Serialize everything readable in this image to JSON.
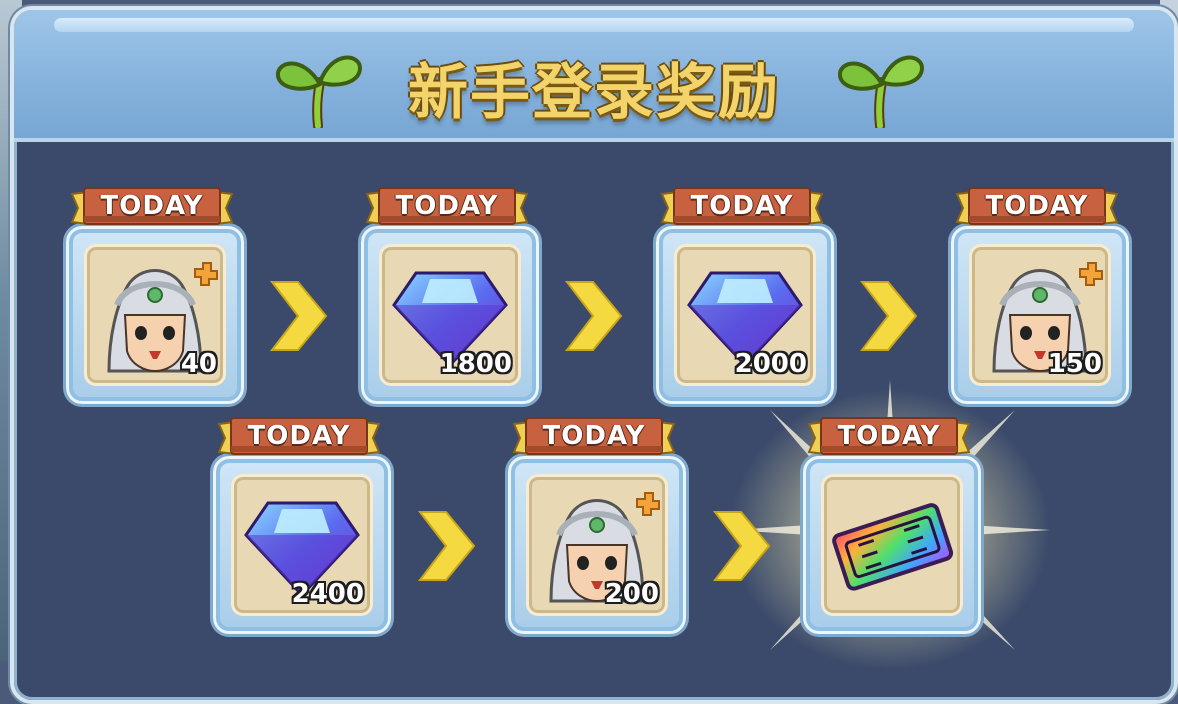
{
  "title": "新手登录奖励",
  "banner_label": "TODAY",
  "rewards": [
    {
      "item": "hero-piece-icon",
      "qty": "40"
    },
    {
      "item": "diamond-icon",
      "qty": "1800"
    },
    {
      "item": "diamond-icon",
      "qty": "2000"
    },
    {
      "item": "hero-piece-icon",
      "qty": "150"
    },
    {
      "item": "diamond-icon",
      "qty": "2400"
    },
    {
      "item": "hero-piece-icon",
      "qty": "200"
    },
    {
      "item": "ssr-ticket-icon",
      "qty": ""
    }
  ],
  "colors": {
    "title": "#f3d46a",
    "banner": "#c8613f",
    "panel": "#3b4a6b",
    "arrow": "#f5d941"
  }
}
